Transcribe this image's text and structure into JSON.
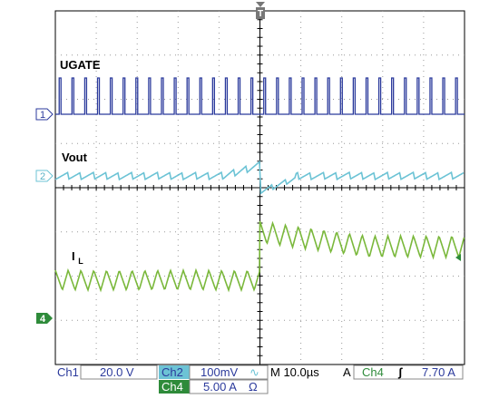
{
  "chart_data": {
    "type": "line",
    "title": "",
    "x_divisions": 10,
    "y_divisions": 8,
    "grid": true,
    "series": [
      {
        "name": "UGATE",
        "channel": "1",
        "color": "#2b3a9c",
        "description": "switch gate pulses, fixed-frequency narrow pulses throughout",
        "pulse_count_before_trigger": 16,
        "pulse_count_after_trigger": 16
      },
      {
        "name": "Vout",
        "channel": "2",
        "color": "#6cc3d5",
        "description": "output voltage ripple; small sawtooth, dip of about one division after load step at trigger"
      },
      {
        "name": "I",
        "name_subscript": "L",
        "channel": "4",
        "color": "#7ab83b",
        "description": "inductor current sawtooth; steps up about 1.6 divisions at trigger, then settles",
        "teeth_before_trigger": 16,
        "teeth_after_trigger": 16
      }
    ],
    "markers": {
      "trigger_position": "center",
      "trigger_icon": "T",
      "channel_markers": [
        "1",
        "2",
        "4"
      ],
      "trigger_level_arrow": "right edge"
    }
  },
  "status": {
    "ch1_label": "Ch1",
    "ch1_value": "20.0 V",
    "ch2_label": "Ch2",
    "ch2_value": "100mV",
    "ch2_coupling_symbol": "∿",
    "ch4_label": "Ch4",
    "ch4_value": "5.00 A",
    "ch4_unit_symbol": "Ω",
    "timebase": "M 10.0µs",
    "trigger_mode": "A",
    "trigger_source": "Ch4",
    "trigger_slope": "ʃ",
    "trigger_level": "7.70 A"
  },
  "colors": {
    "ugate": "#2b3a9c",
    "vout": "#6cc3d5",
    "il": "#7ab83b",
    "status_text": "#2b3a9c",
    "ch_marker_fill": "#2e8b3a",
    "grid": "#888888"
  }
}
